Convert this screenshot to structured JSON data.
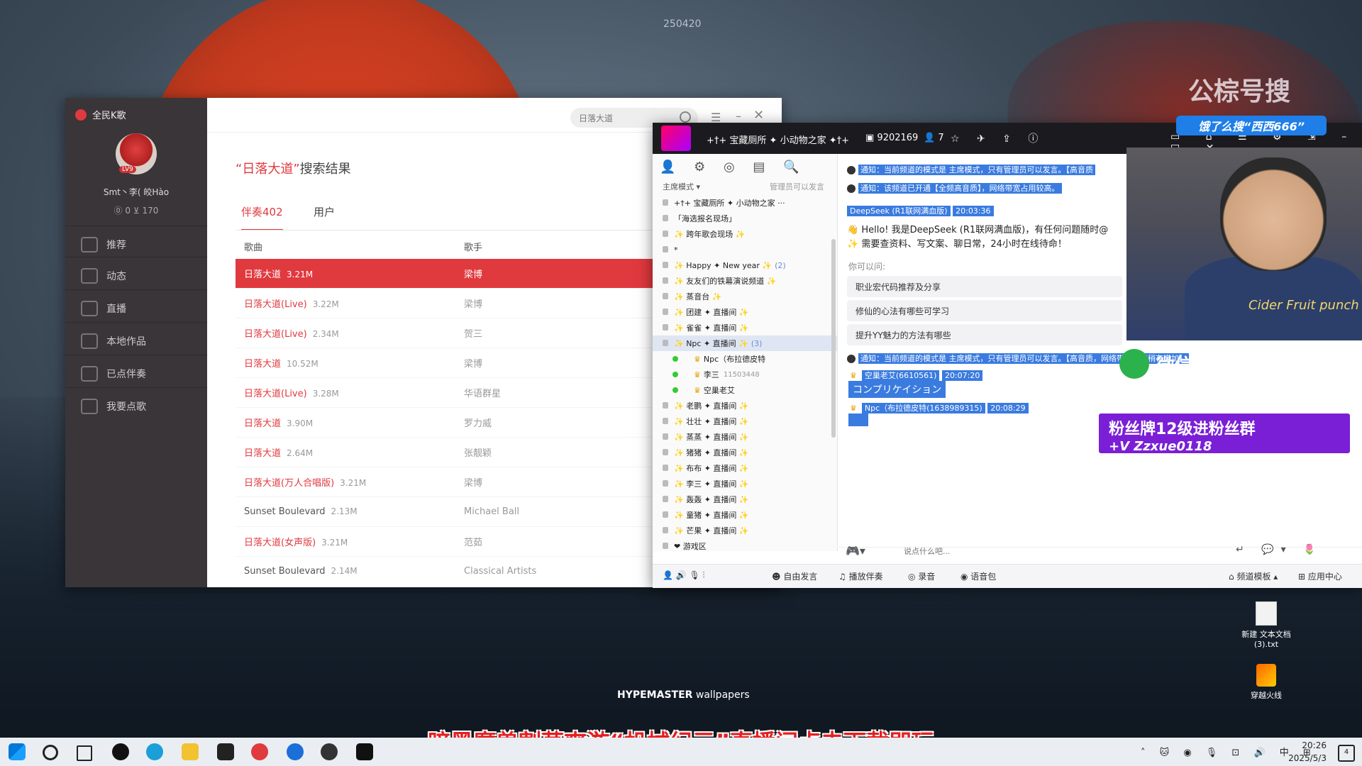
{
  "wallpaper": {
    "id_label": "250420",
    "brand_bold": "HYPEMASTER",
    "brand_rest": " wallpapers",
    "watermark": "公棕号搜"
  },
  "karaoke": {
    "app_name": "全民K歌",
    "level_badge": "LV9",
    "username": "Smt丶李( 皎Hào",
    "stats": "⓪ 0   ⊻ 170",
    "nav": [
      "推荐",
      "动态",
      "直播",
      "本地作品",
      "已点伴奏",
      "我要点歌"
    ],
    "search": {
      "value": "日落大道"
    },
    "result_title_quote": "“日落大道”",
    "result_title_rest": "搜索结果",
    "tabs": [
      "伴奏402",
      "用户"
    ],
    "columns": [
      "歌曲",
      "歌手"
    ],
    "rows": [
      {
        "song": "日落大道",
        "size": "3.21M",
        "singer": "梁博"
      },
      {
        "song": "日落大道(Live)",
        "size": "3.22M",
        "singer": "梁博"
      },
      {
        "song": "日落大道(Live)",
        "size": "2.34M",
        "singer": "贺三"
      },
      {
        "song": "日落大道",
        "size": "10.52M",
        "singer": "梁博"
      },
      {
        "song": "日落大道(Live)",
        "size": "3.28M",
        "singer": "华语群星"
      },
      {
        "song": "日落大道",
        "size": "3.90M",
        "singer": "罗力威"
      },
      {
        "song": "日落大道",
        "size": "2.64M",
        "singer": "张靓颖"
      },
      {
        "song": "日落大道(万人合唱版)",
        "size": "3.21M",
        "singer": "梁博"
      },
      {
        "song": "Sunset Boulevard",
        "size": "2.13M",
        "singer": "Michael Ball"
      },
      {
        "song": "日落大道(女声版)",
        "size": "3.21M",
        "singer": "范茹"
      },
      {
        "song": "Sunset Boulevard",
        "size": "2.14M",
        "singer": "Classical Artists"
      }
    ],
    "accent": "#e0393e"
  },
  "yy": {
    "channel_title": "+†+ 宝藏厕所 ✦ 小动物之家 ✦†+",
    "channel_id": "9202169",
    "online": "7",
    "mode": "主席模式 ▾",
    "mode_right": "管理员可以发言",
    "tree": [
      {
        "label": "+†+ 宝藏厕所 ✦ 小动物之家 ···",
        "type": "root"
      },
      {
        "label": "「海选报名现场」",
        "type": "ch"
      },
      {
        "label": "✨ 跨年歌会现场 ✨",
        "type": "ch"
      },
      {
        "label": "*",
        "type": "ch"
      },
      {
        "label": "✨ Happy ✦ New year ✨",
        "count": "(2)",
        "type": "ch"
      },
      {
        "label": "✨ 友友们的铁幕演说频道 ✨",
        "type": "ch"
      },
      {
        "label": "✨ 蒸音台 ✨",
        "type": "ch"
      },
      {
        "label": "✨ 团建 ✦ 直播间 ✨",
        "type": "ch"
      },
      {
        "label": "✨ 雀雀 ✦ 直播间 ✨",
        "type": "ch"
      },
      {
        "label": "✨ Npc ✦ 直播间 ✨",
        "count": "(3)",
        "type": "sel"
      },
      {
        "label": "Npc（布拉德皮特",
        "type": "user"
      },
      {
        "label": "李三",
        "num": "11503448",
        "type": "user"
      },
      {
        "label": "空巢老艾",
        "type": "user"
      },
      {
        "label": "✨ 老鹏 ✦ 直播间 ✨",
        "type": "ch"
      },
      {
        "label": "✨ 壮壮 ✦ 直播间 ✨",
        "type": "ch"
      },
      {
        "label": "✨ 蒸蒸 ✦ 直播间 ✨",
        "type": "ch"
      },
      {
        "label": "✨ 猪猪 ✦ 直播间 ✨",
        "type": "ch"
      },
      {
        "label": "✨ 布布 ✦ 直播间 ✨",
        "type": "ch"
      },
      {
        "label": "✨ 李三 ✦ 直播间 ✨",
        "type": "ch"
      },
      {
        "label": "✨ 轰轰 ✦ 直播间 ✨",
        "type": "ch"
      },
      {
        "label": "✨ 童猪 ✦ 直播间 ✨",
        "type": "ch"
      },
      {
        "label": "✨ 芒果 ✦ 直播间 ✨",
        "type": "ch"
      },
      {
        "label": "❤ 游戏区",
        "type": "ch"
      }
    ],
    "notice1": "通知：当前频道的模式是 主席模式，只有管理员可以发言。【高音质",
    "notice2": "通知：该频道已开通【全频高音质】，网络带宽占用较高。",
    "ds_name": "DeepSeek (R1联网满血版)",
    "ds_time": "20:03:36",
    "ds_msg1": "👋 Hello! 我是DeepSeek (R1联网满血版)，有任何问题随时@",
    "ds_msg2": "✨ 需要查资料、写文案、聊日常，24小时在线待命！",
    "ask": "你可以问:",
    "suggestions": [
      "职业宏代码推荐及分享",
      "修仙的心法有哪些可学习",
      "提升YY魅力的方法有哪些"
    ],
    "notice3": "通知：当前频道的模式是 主席模式，只有管理员可以发言。【高音质，网络带宽占用稍有增加】",
    "msg1_name": "空巢老艾(6610561)",
    "msg1_time": "20:07:20",
    "msg1_text": "コンプリケイション",
    "msg2_name": "Npc（布拉德皮特(1638989315)",
    "msg2_time": "20:08:29",
    "input_placeholder": "说点什么吧...",
    "bottom_buttons": [
      "自由发言",
      "播放伴奏",
      "录音",
      "语音包",
      "频道模板 ▴",
      "应用中心"
    ]
  },
  "overlay": {
    "search_pill_prefix": "饿了么搜",
    "search_pill_term": "“西西666”",
    "wechat": "微信: Zzxue0118",
    "fan_line1": "粉丝牌12级进粉丝群",
    "fan_line2": "+V Zzxue0118",
    "shirt_text": "Cider Fruit punch"
  },
  "desktop": {
    "icons": [
      "新建 文本文档 (3).txt",
      "穿越火线"
    ]
  },
  "promo": "暗黑魔兽割草爽游“机械纪元”直播间点击下载即玩",
  "taskbar": {
    "time": "20:26",
    "date": "2025/5/3",
    "ime": "中",
    "notif": "4"
  }
}
